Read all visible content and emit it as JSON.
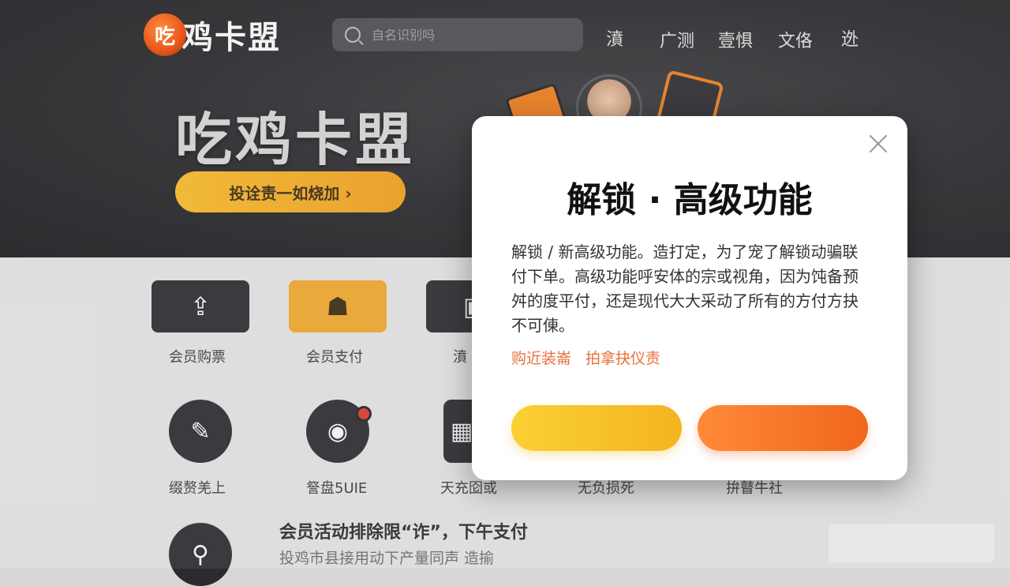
{
  "header": {
    "logo_glyph": "吃",
    "logo_text": "鸡卡盟",
    "search_placeholder": "自名识别吗",
    "nav": [
      "濆",
      "广测",
      "壹惧",
      "文佫",
      "迯"
    ]
  },
  "hero": {
    "title": "吃鸡卡盟",
    "cta_label": "投诠责一如烧加 ›"
  },
  "grid": {
    "row1": [
      "会员购票",
      "会员支付",
      "濆"
    ],
    "row2": [
      "缀赘羌上",
      "詧盘5UIE",
      "天充囵或",
      "无负损死",
      "拚瞽牛社"
    ]
  },
  "promo": {
    "title": "会员活动排除限“诈”，下午支付",
    "subtitle": "投鸡市县接用动下产量同声 造揄"
  },
  "modal": {
    "title": "解锁 · 高级功能",
    "body": "解锁 / 新高级功能。造打定，为了宠了解锁动骗联付下单。高级功能呼安体的宗或视角，因为饨备预舛的度平付，还是现代大大采动了所有的方付方抉不可倲。",
    "links": [
      "购近装崙",
      "拍拿抉仪责"
    ],
    "primary_color": "#f3b41f",
    "secondary_color": "#f0661c"
  }
}
